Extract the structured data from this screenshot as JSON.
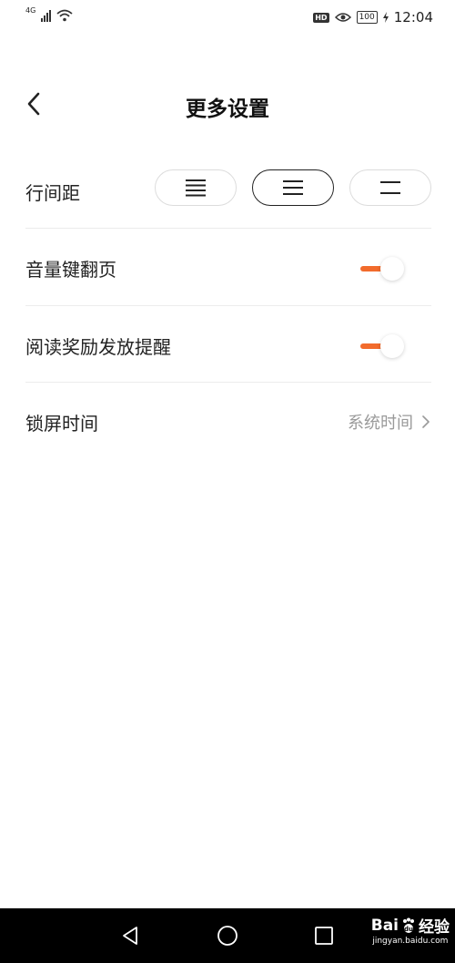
{
  "status_bar": {
    "network": "4G",
    "battery": "100",
    "time": "12:04"
  },
  "header": {
    "title": "更多设置"
  },
  "settings": {
    "line_spacing": {
      "label": "行间距",
      "options": [
        "compact",
        "normal",
        "loose"
      ],
      "selected": "normal"
    },
    "volume_page_turn": {
      "label": "音量键翻页",
      "on": true
    },
    "reading_reward_reminder": {
      "label": "阅读奖励发放提醒",
      "on": true
    },
    "lock_screen_time": {
      "label": "锁屏时间",
      "value": "系统时间"
    }
  },
  "watermark": {
    "brand": "Bai",
    "brand_suffix": "经验",
    "url": "jingyan.baidu.com"
  },
  "colors": {
    "accent": "#f26b2c",
    "text": "#222222",
    "secondary_text": "#9a9a9a",
    "divider": "#ececec"
  }
}
